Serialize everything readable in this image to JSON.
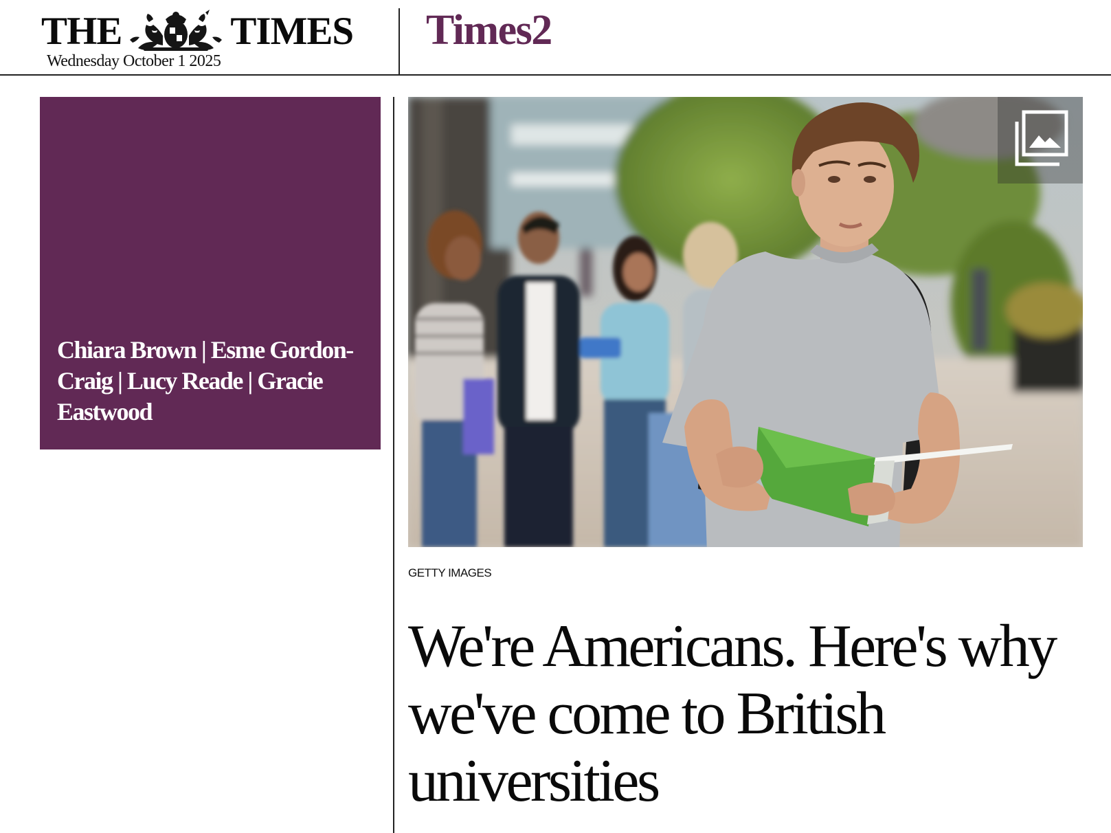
{
  "colors": {
    "accent_purple": "#612955",
    "rule": "#222222",
    "text": "#111111"
  },
  "masthead": {
    "brand_left": "THE",
    "brand_right": "TIMES",
    "crest_icon": "royal-crest-icon",
    "date": "Wednesday October 1 2025",
    "section": "Times2"
  },
  "author_box": {
    "authors": "Chiara Brown | Esme Gordon-Craig | Lucy Reade | Gracie Eastwood"
  },
  "hero": {
    "gallery_icon": "image-gallery-icon",
    "credit": "GETTY IMAGES"
  },
  "article": {
    "headline": "We're Americans. Here's why we've come to British universities"
  }
}
